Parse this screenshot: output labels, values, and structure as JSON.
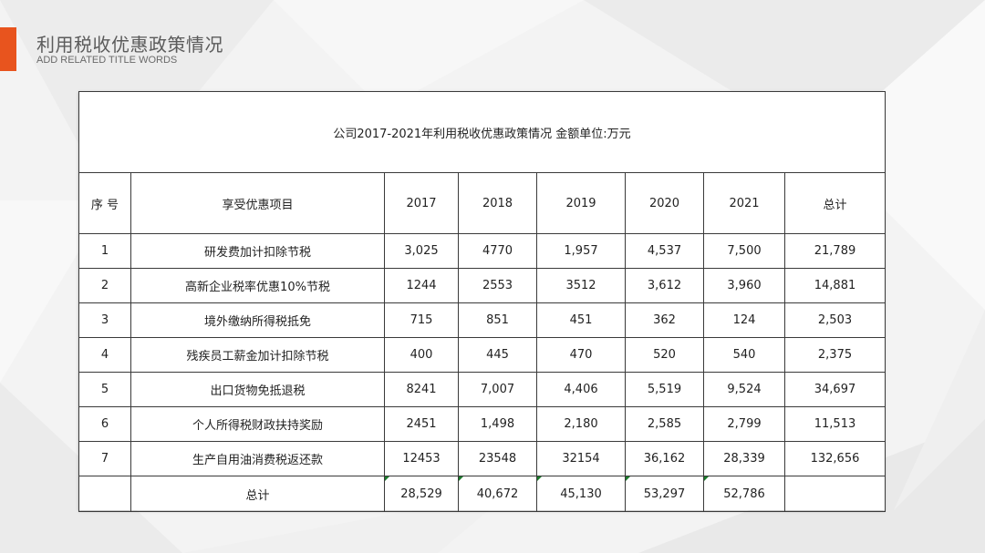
{
  "header": {
    "title": "利用税收优惠政策情况",
    "subtitle": "ADD RELATED TITLE WORDS",
    "accent_color": "#e8541e"
  },
  "table": {
    "caption": "公司2017-2021年利用税收优惠政策情况 金额单位:万元",
    "columns": [
      "序 号",
      "享受优惠项目",
      "2017",
      "2018",
      "2019",
      "2020",
      "2021",
      "总计"
    ],
    "rows": [
      {
        "no": "1",
        "item": "研发费加计扣除节税",
        "y2017": "3,025",
        "y2018": "4770",
        "y2019": "1,957",
        "y2020": "4,537",
        "y2021": "7,500",
        "total": "21,789"
      },
      {
        "no": "2",
        "item": "高新企业税率优惠10%节税",
        "y2017": "1244",
        "y2018": "2553",
        "y2019": "3512",
        "y2020": "3,612",
        "y2021": "3,960",
        "total": "14,881"
      },
      {
        "no": "3",
        "item": "境外缴纳所得税抵免",
        "y2017": "715",
        "y2018": "851",
        "y2019": "451",
        "y2020": "362",
        "y2021": "124",
        "total": "2,503"
      },
      {
        "no": "4",
        "item": "残疾员工薪金加计扣除节税",
        "y2017": "400",
        "y2018": "445",
        "y2019": "470",
        "y2020": "520",
        "y2021": "540",
        "total": "2,375"
      },
      {
        "no": "5",
        "item": "出口货物免抵退税",
        "y2017": "8241",
        "y2018": "7,007",
        "y2019": "4,406",
        "y2020": "5,519",
        "y2021": "9,524",
        "total": "34,697"
      },
      {
        "no": "6",
        "item": "个人所得税财政扶持奖励",
        "y2017": "2451",
        "y2018": "1,498",
        "y2019": "2,180",
        "y2020": "2,585",
        "y2021": "2,799",
        "total": "11,513"
      },
      {
        "no": "7",
        "item": "生产自用油消费税返还款",
        "y2017": "12453",
        "y2018": "23548",
        "y2019": "32154",
        "y2020": "36,162",
        "y2021": "28,339",
        "total": "132,656"
      }
    ],
    "total_row": {
      "no": "",
      "item": "总计",
      "y2017": "28,529",
      "y2018": "40,672",
      "y2019": "45,130",
      "y2020": "53,297",
      "y2021": "52,786",
      "total": ""
    },
    "formula_marker_color": "#1b7a2b"
  }
}
